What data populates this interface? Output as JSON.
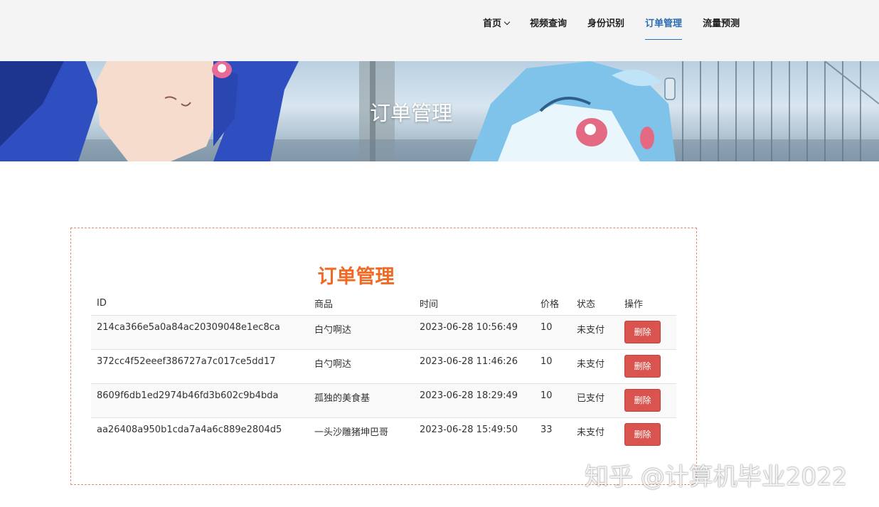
{
  "nav": {
    "items": [
      {
        "label": "首页",
        "has_dropdown": true,
        "active": false
      },
      {
        "label": "视频查询",
        "active": false
      },
      {
        "label": "身份识别",
        "active": false
      },
      {
        "label": "订单管理",
        "active": true
      },
      {
        "label": "流量预测",
        "active": false
      }
    ],
    "active_color": "#2b6cb0"
  },
  "banner": {
    "title": "订单管理"
  },
  "orders": {
    "title": "订单管理",
    "title_color": "#ef6a24",
    "columns": [
      "ID",
      "商品",
      "时间",
      "价格",
      "状态",
      "操作"
    ],
    "rows": [
      {
        "id": "214ca366e5a0a84ac20309048e1ec8ca",
        "goods": "白勺啊达",
        "time": "2023-06-28 10:56:49",
        "price": "10",
        "status": "未支付",
        "action": "删除"
      },
      {
        "id": "372cc4f52eeef386727a7c017ce5dd17",
        "goods": "白勺啊达",
        "time": "2023-06-28 11:46:26",
        "price": "10",
        "status": "未支付",
        "action": "删除"
      },
      {
        "id": "8609f6db1ed2974b46fd3b602c9b4bda",
        "goods": "孤独的美食基",
        "time": "2023-06-28 18:29:49",
        "price": "10",
        "status": "已支付",
        "action": "删除"
      },
      {
        "id": "aa26408a950b1cda7a4a6c889e2804d5",
        "goods": "一头沙雕猪坤巴哥",
        "time": "2023-06-28 15:49:50",
        "price": "33",
        "status": "未支付",
        "action": "删除"
      }
    ],
    "delete_color": "#d9534f"
  },
  "watermark": "知乎 @计算机毕业2022"
}
